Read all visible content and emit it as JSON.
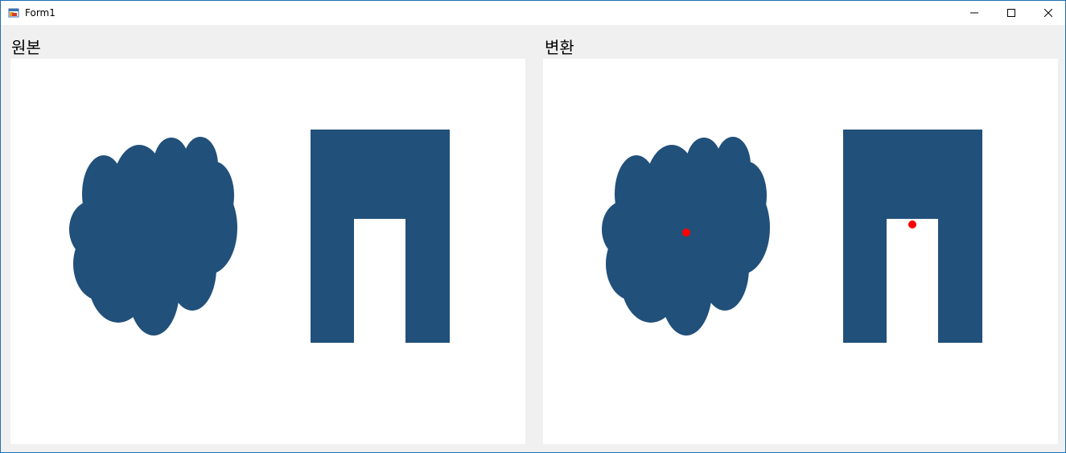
{
  "window": {
    "title": "Form1",
    "icon": "winforms-app-icon",
    "controls": [
      "minimize-icon",
      "maximize-icon",
      "close-icon"
    ]
  },
  "labels": {
    "original": "원본",
    "transformed": "변환"
  },
  "colors": {
    "shape_fill": "#21507a",
    "marker": "#ff0000",
    "panel_bg": "#ffffff",
    "form_bg": "#f0f0f0",
    "window_border": "#1c6fb5"
  }
}
